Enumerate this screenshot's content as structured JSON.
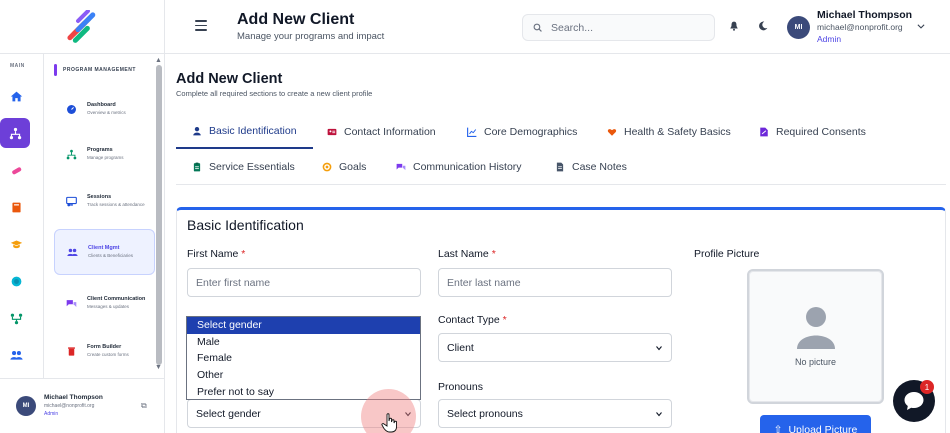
{
  "header": {
    "title": "Add New Client",
    "subtitle": "Manage your programs and impact",
    "search_placeholder": "Search...",
    "user": {
      "initials": "MI",
      "name": "Michael Thompson",
      "email": "michael@nonprofit.org",
      "role": "Admin"
    }
  },
  "rail": {
    "label": "MAIN",
    "items": [
      "home-icon",
      "network-icon",
      "pill-icon",
      "book-icon",
      "graduation-icon",
      "globe-icon",
      "flow-icon",
      "users-icon"
    ]
  },
  "panel": {
    "heading": "PROGRAM MANAGEMENT",
    "items": [
      {
        "title": "Dashboard",
        "desc": "Overview & metrics",
        "icon": "gauge-icon"
      },
      {
        "title": "Programs",
        "desc": "Manage programs",
        "icon": "network-icon"
      },
      {
        "title": "Sessions",
        "desc": "Track sessions & attendance",
        "icon": "screen-icon"
      },
      {
        "title": "Client Mgmt",
        "desc": "Clients & Beneficiaries",
        "icon": "users-icon"
      },
      {
        "title": "Client Communication",
        "desc": "Messages & updates",
        "icon": "chat-icon"
      },
      {
        "title": "Form Builder",
        "desc": "Create custom forms",
        "icon": "trash-icon"
      }
    ]
  },
  "footer_user": {
    "initials": "MI",
    "name": "Michael Thompson",
    "email": "michael@nonprofit.org",
    "role": "Admin"
  },
  "main": {
    "title": "Add New Client",
    "subtitle": "Complete all required sections to create a new client profile",
    "tabs": [
      {
        "label": "Basic Identification",
        "icon": "person-icon",
        "active": true
      },
      {
        "label": "Contact Information",
        "icon": "id-card-icon"
      },
      {
        "label": "Core Demographics",
        "icon": "chart-icon"
      },
      {
        "label": "Health & Safety Basics",
        "icon": "heart-icon"
      },
      {
        "label": "Required Consents",
        "icon": "signature-icon"
      },
      {
        "label": "Service Essentials",
        "icon": "clipboard-icon"
      },
      {
        "label": "Goals",
        "icon": "target-icon"
      },
      {
        "label": "Communication History",
        "icon": "comments-icon"
      },
      {
        "label": "Case Notes",
        "icon": "file-icon"
      }
    ],
    "section_title": "Basic Identification",
    "fields": {
      "first_name": {
        "label": "First Name",
        "req": "*",
        "placeholder": "Enter first name"
      },
      "last_name": {
        "label": "Last Name",
        "req": "*",
        "placeholder": "Enter last name"
      },
      "contact_type": {
        "label": "Contact Type",
        "req": "*",
        "value": "Client"
      },
      "gender": {
        "value": "Select gender"
      },
      "pronouns": {
        "label": "Pronouns",
        "value": "Select pronouns"
      }
    },
    "profile_picture": {
      "label": "Profile Picture",
      "empty_text": "No picture",
      "upload_label": "Upload Picture"
    },
    "gender_options": [
      "Select gender",
      "Male",
      "Female",
      "Other",
      "Prefer not to say"
    ]
  },
  "chat": {
    "badge": "1"
  },
  "colors": {
    "accent": "#6d3fd8",
    "primary": "#2563eb",
    "tab_active": "#1e3a8a"
  }
}
